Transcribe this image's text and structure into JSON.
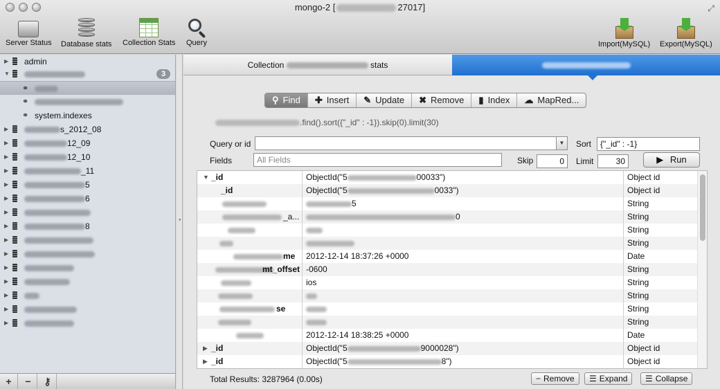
{
  "window": {
    "title_prefix": "mongo-2 [",
    "title_suffix": "27017]"
  },
  "toolbar": {
    "server_status": "Server Status",
    "database_stats": "Database stats",
    "collection_stats": "Collection Stats",
    "query": "Query",
    "import": "Import(MySQL)",
    "export": "Export(MySQL)"
  },
  "sidebar": {
    "admin": "admin",
    "badge": "3",
    "system_indexes": "system.indexes",
    "partial_labels": [
      "s_2012_08",
      "12_09",
      "12_10",
      "_11",
      "5",
      "6",
      "8"
    ]
  },
  "tabs": {
    "collection_prefix": "Collection",
    "collection_suffix": "stats"
  },
  "segment": {
    "find": "Find",
    "insert": "Insert",
    "update": "Update",
    "remove": "Remove",
    "index": "Index",
    "mapreduce": "MapRed..."
  },
  "query_line": ".find().sort({\"_id\" : -1}).skip(0).limit(30)",
  "form": {
    "query_label": "Query or id",
    "sort_label": "Sort",
    "sort_value": "{\"_id\" : -1}",
    "fields_label": "Fields",
    "fields_placeholder": "All Fields",
    "skip_label": "Skip",
    "skip_value": "0",
    "limit_label": "Limit",
    "limit_value": "30",
    "run": "Run"
  },
  "results": {
    "rows": [
      {
        "key": "_id",
        "value_a": "ObjectId(\"5",
        "value_b": "00033\")",
        "type": "Object id"
      },
      {
        "key": "_id",
        "value_a": "ObjectId(\"5",
        "value_b": "0033\")",
        "type": "Object id"
      },
      {
        "key": "",
        "value_a": "",
        "value_b": "5",
        "type": "String"
      },
      {
        "key": "_a...",
        "value_a": "",
        "value_b": "0",
        "type": "String"
      },
      {
        "key": "",
        "value_a": "",
        "value_b": "",
        "type": "String"
      },
      {
        "key": "",
        "value_a": "",
        "value_b": "",
        "type": "String"
      },
      {
        "key": "me",
        "value_a": "2012-12-14 18:37:26 +0000",
        "value_b": "",
        "type": "Date"
      },
      {
        "key": "mt_offset",
        "value_a": "-0600",
        "value_b": "",
        "type": "String"
      },
      {
        "key": "",
        "value_a": "ios",
        "value_b": "",
        "type": "String"
      },
      {
        "key": "",
        "value_a": "",
        "value_b": "",
        "type": "String"
      },
      {
        "key": "se",
        "value_a": "",
        "value_b": "",
        "type": "String"
      },
      {
        "key": "",
        "value_a": "",
        "value_b": "",
        "type": "String"
      },
      {
        "key": "",
        "value_a": "2012-12-14 18:38:25 +0000",
        "value_b": "",
        "type": "Date"
      },
      {
        "key": "_id",
        "value_a": "ObjectId(\"5",
        "value_b": "9000028\")",
        "type": "Object id"
      },
      {
        "key": "_id",
        "value_a": "ObjectId(\"5",
        "value_b": "8\")",
        "type": "Object id"
      }
    ]
  },
  "footer": {
    "total": "Total Results: 3287964 (0.00s)",
    "remove": "Remove",
    "expand": "Expand",
    "collapse": "Collapse"
  }
}
